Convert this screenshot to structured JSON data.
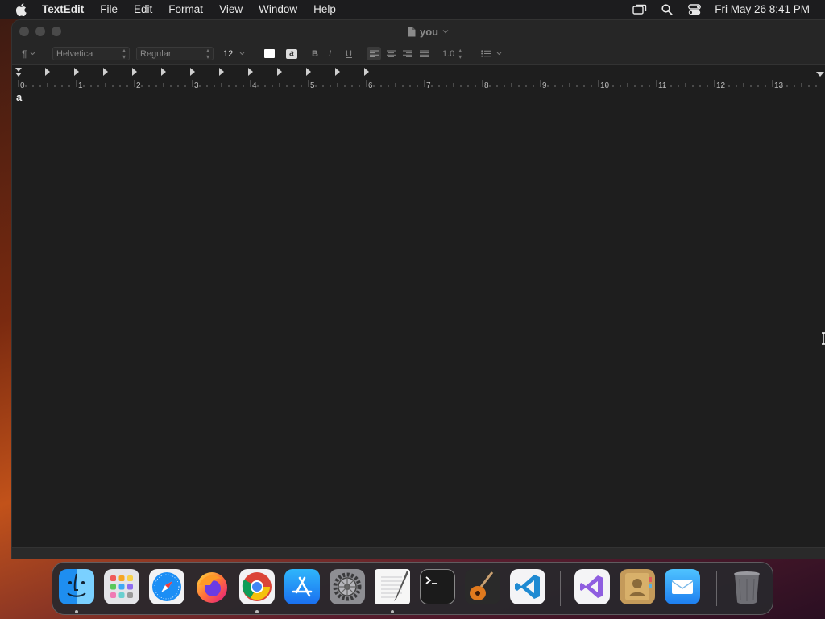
{
  "menubar": {
    "app_name": "TextEdit",
    "menus": [
      "File",
      "Edit",
      "Format",
      "View",
      "Window",
      "Help"
    ],
    "clock": "Fri May 26  8:41 PM",
    "status_icons": [
      "screen-mirroring-icon",
      "spotlight-search-icon",
      "control-center-icon"
    ]
  },
  "window": {
    "title": "you",
    "toolbar": {
      "paragraph_symbol": "¶",
      "font_family": "Helvetica",
      "font_style": "Regular",
      "font_size": "12",
      "bold_label": "B",
      "italic_label": "I",
      "underline_label": "U",
      "line_spacing": "1.0"
    },
    "ruler_numbers": [
      "0",
      "1",
      "2",
      "3",
      "4",
      "5",
      "6",
      "7",
      "8",
      "9",
      "10",
      "11",
      "12",
      "13"
    ],
    "document_text": "a"
  },
  "dock": {
    "apps": [
      {
        "name": "Finder",
        "running": true
      },
      {
        "name": "Launchpad",
        "running": false
      },
      {
        "name": "Safari",
        "running": false
      },
      {
        "name": "Firefox",
        "running": false
      },
      {
        "name": "Google Chrome",
        "running": true
      },
      {
        "name": "App Store",
        "running": false
      },
      {
        "name": "System Preferences",
        "running": false
      },
      {
        "name": "TextEdit",
        "running": true
      },
      {
        "name": "Terminal",
        "running": false
      },
      {
        "name": "GarageBand",
        "running": false
      },
      {
        "name": "Visual Studio Code",
        "running": false
      },
      {
        "name": "Visual Studio",
        "running": false
      },
      {
        "name": "Contacts",
        "running": false
      },
      {
        "name": "Mail",
        "running": false
      },
      {
        "name": "Trash",
        "running": false
      }
    ]
  },
  "colors": {
    "menubar_bg": "#1c1c1e",
    "window_bg": "#1e1e1e",
    "toolbar_bg": "#262626"
  }
}
